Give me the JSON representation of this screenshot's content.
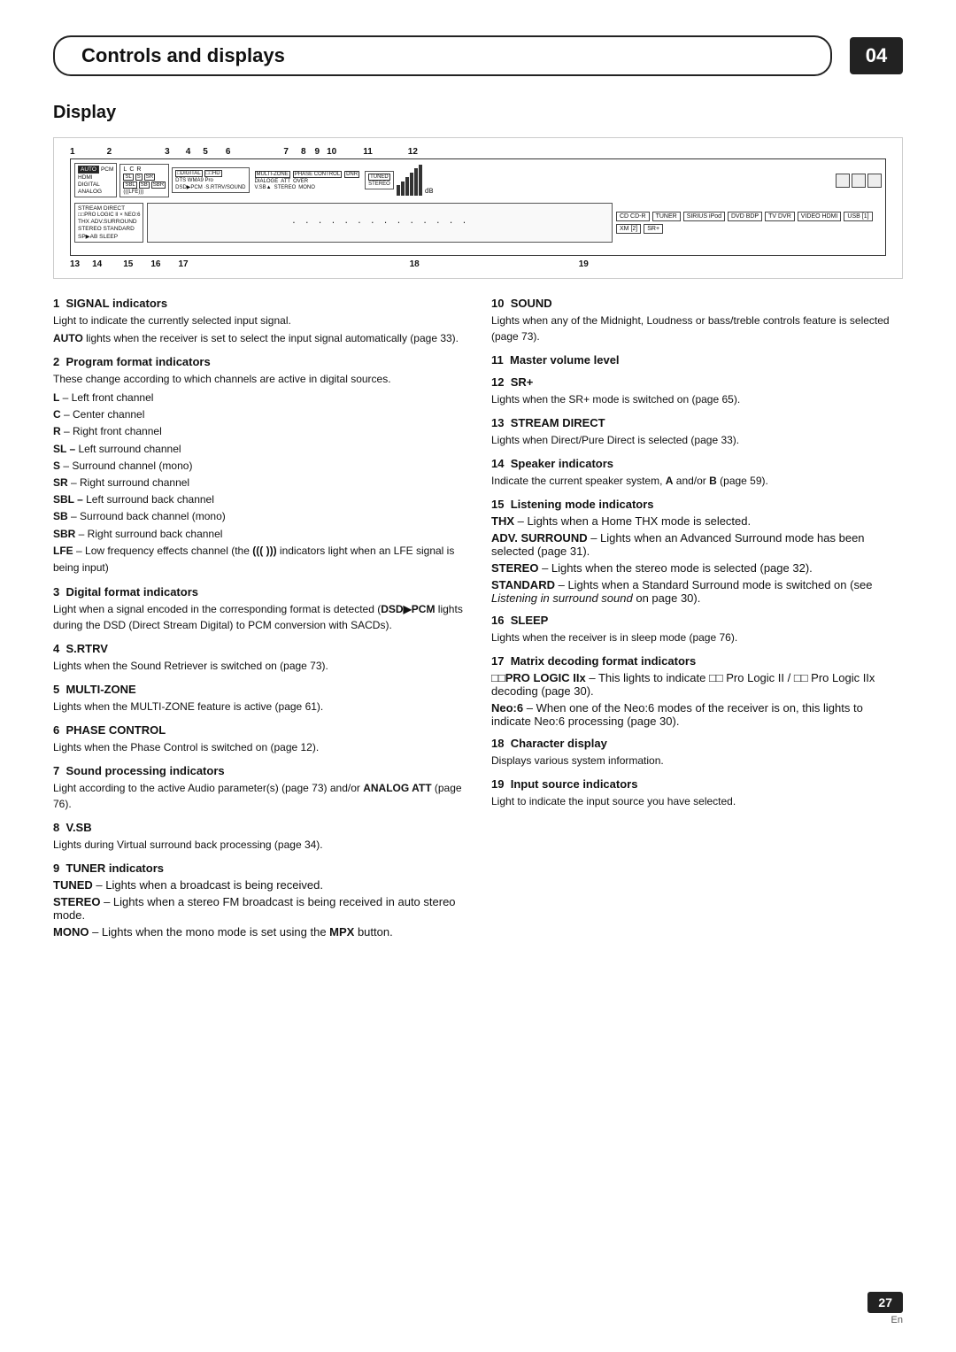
{
  "header": {
    "title": "Controls and displays",
    "chapter": "04"
  },
  "section": {
    "title": "Display"
  },
  "diagram": {
    "numbers_top": [
      "1",
      "2",
      "3",
      "4",
      "5",
      "6",
      "7",
      "8",
      "9",
      "10",
      "11",
      "12"
    ],
    "numbers_bottom": [
      "13",
      "14",
      "15",
      "16",
      "17",
      "18",
      "19"
    ]
  },
  "indicators": [
    {
      "num": "1",
      "title": "SIGNAL indicators",
      "body": "Light to indicate the currently selected input signal.",
      "details": [
        {
          "term": "AUTO",
          "text": " lights when the receiver is set to select the input signal automatically (page 33)."
        }
      ]
    },
    {
      "num": "2",
      "title": "Program format indicators",
      "body": "These change according to which channels are active in digital sources.",
      "list": [
        {
          "term": "L",
          "text": " – Left front channel"
        },
        {
          "term": "C",
          "text": " – Center channel"
        },
        {
          "term": "R",
          "text": " – Right front channel"
        },
        {
          "term": "SL –",
          "text": " Left surround channel"
        },
        {
          "term": "S",
          "text": " – Surround channel (mono)"
        },
        {
          "term": "SR",
          "text": " – Right surround channel"
        },
        {
          "term": "SBL –",
          "text": " Left surround back channel"
        },
        {
          "term": "SB",
          "text": " – Surround back channel (mono)"
        },
        {
          "term": "SBR",
          "text": " – Right surround back channel"
        },
        {
          "term": "LFE",
          "text": " – Low frequency effects channel (the ((( ))) indicators light when an LFE signal is being input)"
        }
      ]
    },
    {
      "num": "3",
      "title": "Digital format indicators",
      "body": "Light when a signal encoded in the corresponding format is detected (DSD▶PCM lights during the DSD (Direct Stream Digital) to PCM conversion with SACDs)."
    },
    {
      "num": "4",
      "title": "S.RTRV",
      "body": "Lights when the Sound Retriever is switched on (page 73)."
    },
    {
      "num": "5",
      "title": "MULTI-ZONE",
      "body": "Lights when the MULTI-ZONE feature is active (page 61)."
    },
    {
      "num": "6",
      "title": "PHASE CONTROL",
      "body": "Lights when the Phase Control is switched on (page 12)."
    },
    {
      "num": "7",
      "title": "Sound processing indicators",
      "body": "Light according to the active Audio parameter(s) (page 73) and/or ANALOG ATT (page 76)."
    },
    {
      "num": "8",
      "title": "V.SB",
      "body": "Lights during Virtual surround back processing (page 34)."
    },
    {
      "num": "9",
      "title": "TUNER indicators",
      "subs": [
        {
          "term": "TUNED",
          "text": " – Lights when a broadcast is being received."
        },
        {
          "term": "STEREO",
          "text": " – Lights when a stereo FM broadcast is being received in auto stereo mode."
        },
        {
          "term": "MONO",
          "text": " – Lights when the mono mode is set using the MPX button."
        }
      ]
    },
    {
      "num": "10",
      "title": "SOUND",
      "body": "Lights when any of the Midnight, Loudness or bass/treble controls feature is selected (page 73)."
    },
    {
      "num": "11",
      "title": "Master volume level"
    },
    {
      "num": "12",
      "title": "SR+",
      "body": "Lights when the SR+ mode is switched on (page 65)."
    },
    {
      "num": "13",
      "title": "STREAM DIRECT",
      "body": "Lights when Direct/Pure Direct is selected (page 33)."
    },
    {
      "num": "14",
      "title": "Speaker indicators",
      "body": "Indicate the current speaker system, A and/or B (page 59)."
    },
    {
      "num": "15",
      "title": "Listening mode indicators",
      "subs": [
        {
          "term": "THX",
          "text": " – Lights when a Home THX mode is selected."
        },
        {
          "term": "ADV. SURROUND",
          "text": " – Lights when an Advanced Surround mode has been selected (page 31)."
        },
        {
          "term": "STEREO",
          "text": " – Lights when the stereo mode is selected (page 32)."
        },
        {
          "term": "STANDARD",
          "text": " – Lights when a Standard Surround mode is switched on (see Listening in surround sound on page 30)."
        }
      ]
    },
    {
      "num": "16",
      "title": "SLEEP",
      "body": "Lights when the receiver is in sleep mode (page 76)."
    },
    {
      "num": "17",
      "title": "Matrix decoding format indicators",
      "subs": [
        {
          "term": "□□PRO LOGIC IIx",
          "text": " – This lights to indicate □□ Pro Logic II / □□ Pro Logic IIx decoding (page 30)."
        },
        {
          "term": "Neo:6",
          "text": " – When one of the Neo:6 modes of the receiver is on, this lights to indicate Neo:6 processing (page 30)."
        }
      ]
    },
    {
      "num": "18",
      "title": "Character display",
      "body": "Displays various system information."
    },
    {
      "num": "19",
      "title": "Input source indicators",
      "body": "Light to indicate the input source you have selected."
    }
  ],
  "footer": {
    "page_number": "27",
    "language": "En"
  }
}
